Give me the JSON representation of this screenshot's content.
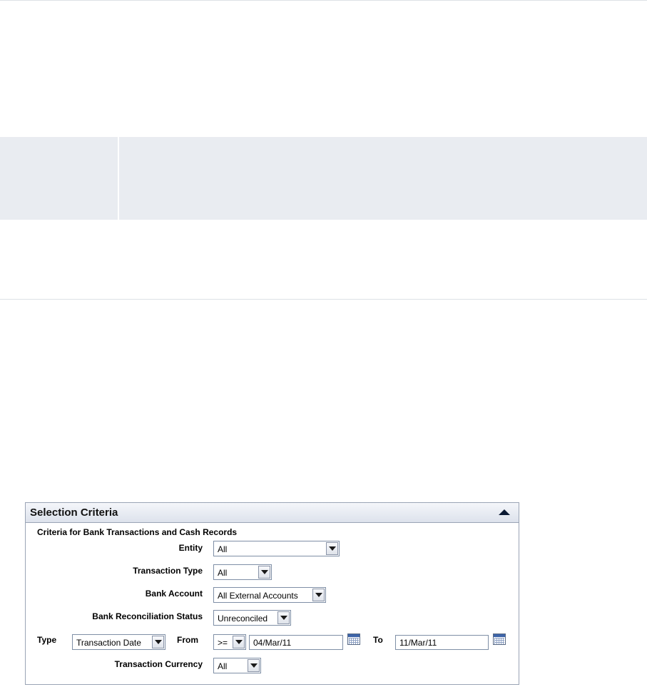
{
  "panel": {
    "title": "Selection Criteria",
    "subheading": "Criteria for Bank Transactions and Cash Records"
  },
  "fields": {
    "entity": {
      "label": "Entity",
      "value": "All"
    },
    "transaction_type": {
      "label": "Transaction Type",
      "value": "All"
    },
    "bank_account": {
      "label": "Bank Account",
      "value": "All External Accounts"
    },
    "reconciliation_status": {
      "label": "Bank Reconciliation Status",
      "value": "Unreconciled"
    },
    "type": {
      "label": "Type",
      "value": "Transaction Date"
    },
    "from": {
      "label": "From",
      "operator": ">=",
      "date": "04/Mar/11"
    },
    "to": {
      "label": "To",
      "date": "11/Mar/11"
    },
    "currency": {
      "label": "Transaction Currency",
      "value": "All"
    }
  },
  "icons": {
    "collapse": "triangle-up-icon",
    "calendar": "calendar-icon",
    "dropdown": "chevron-down-icon"
  }
}
